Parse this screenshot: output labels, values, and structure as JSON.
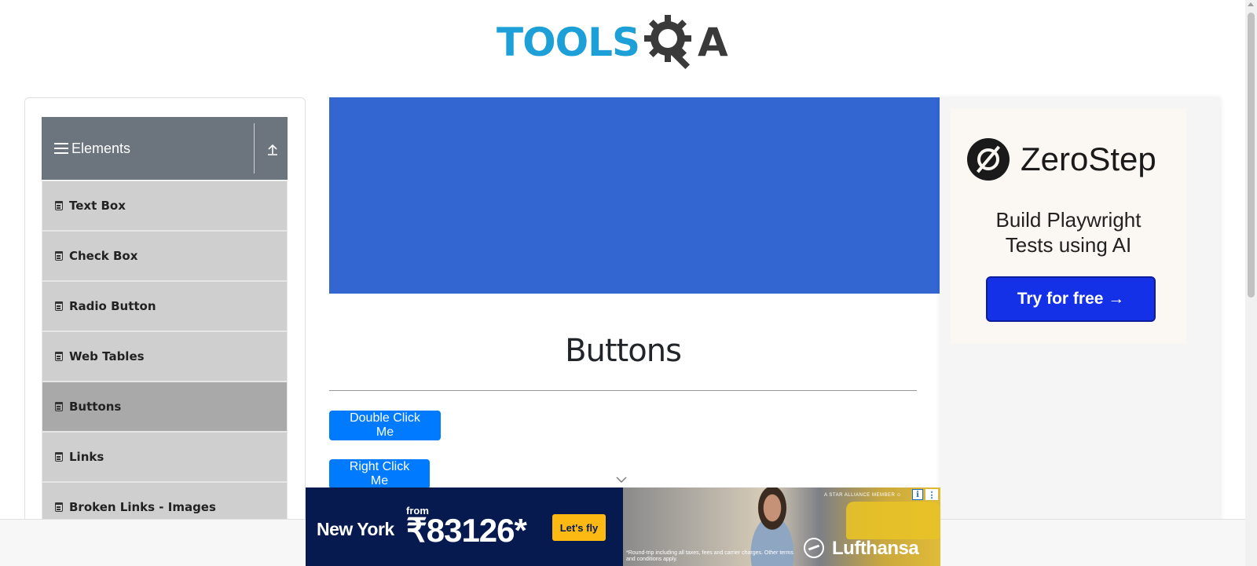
{
  "header": {
    "logo_part1": "TOOLS",
    "logo_part2": "A",
    "logo_icon": "gear-magnifier-icon"
  },
  "sidebar": {
    "group_title": "Elements",
    "items": [
      {
        "label": "Text Box",
        "active": false
      },
      {
        "label": "Check Box",
        "active": false
      },
      {
        "label": "Radio Button",
        "active": false
      },
      {
        "label": "Web Tables",
        "active": false
      },
      {
        "label": "Buttons",
        "active": true
      },
      {
        "label": "Links",
        "active": false
      },
      {
        "label": "Broken Links - Images",
        "active": false
      }
    ]
  },
  "main": {
    "title": "Buttons",
    "buttons": {
      "double_click": "Double Click Me",
      "right_click": "Right Click Me"
    },
    "banner_color": "#3366d1"
  },
  "side_ad": {
    "brand": "ZeroStep",
    "headline_line1": "Build Playwright",
    "headline_line2": "Tests using AI",
    "cta": "Try for free →"
  },
  "bottom_ad": {
    "from": "from",
    "city": "New York",
    "price": "₹83126*",
    "cta": "Let's fly",
    "alliance": "A STAR ALLIANCE MEMBER ✩",
    "fine_print": "*Round-trip including all taxes, fees and carrier charges. Other terms and conditions apply.",
    "brand": "Lufthansa",
    "info": "i",
    "more": "⋮"
  },
  "colors": {
    "primary_button": "#007bff",
    "sidebar_header": "#6c757d",
    "logo_blue": "#1d9fd8"
  }
}
